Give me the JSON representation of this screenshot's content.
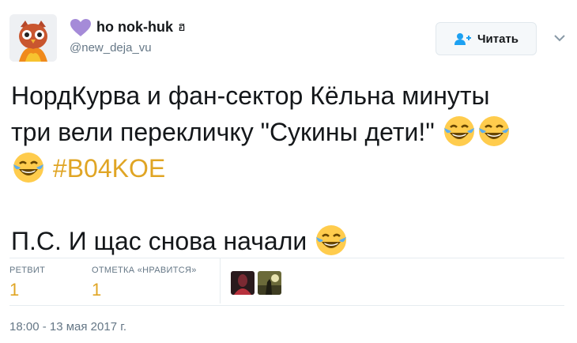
{
  "header": {
    "display_name": "ho nok-huk",
    "name_suffix": "ฮ",
    "handle": "@new_deja_vu",
    "avatar_icon": "owl-avatar-icon",
    "heart_icon": "purple-heart-icon",
    "heart_color": "#a58bd8"
  },
  "follow_button": {
    "label": "Читать",
    "icon": "add-user-icon"
  },
  "tweet": {
    "line1": "НордКурва и фан-сектор Кёльна минуты",
    "line2": "три вели перекличку \"Сукины дети!\"",
    "hashtag": "#B04KOE",
    "line4": "П.С. И щас снова начали",
    "emoji": "face-with-tears-of-joy-icon"
  },
  "stats": {
    "retweets_label": "РЕТВИТ",
    "retweets_value": "1",
    "likes_label": "ОТМЕТКА «НРАВИТСЯ»",
    "likes_value": "1"
  },
  "timestamp": "18:00 - 13 мая 2017 г.",
  "colors": {
    "accent": "#e0a524",
    "muted": "#657786",
    "text": "#14171a"
  }
}
